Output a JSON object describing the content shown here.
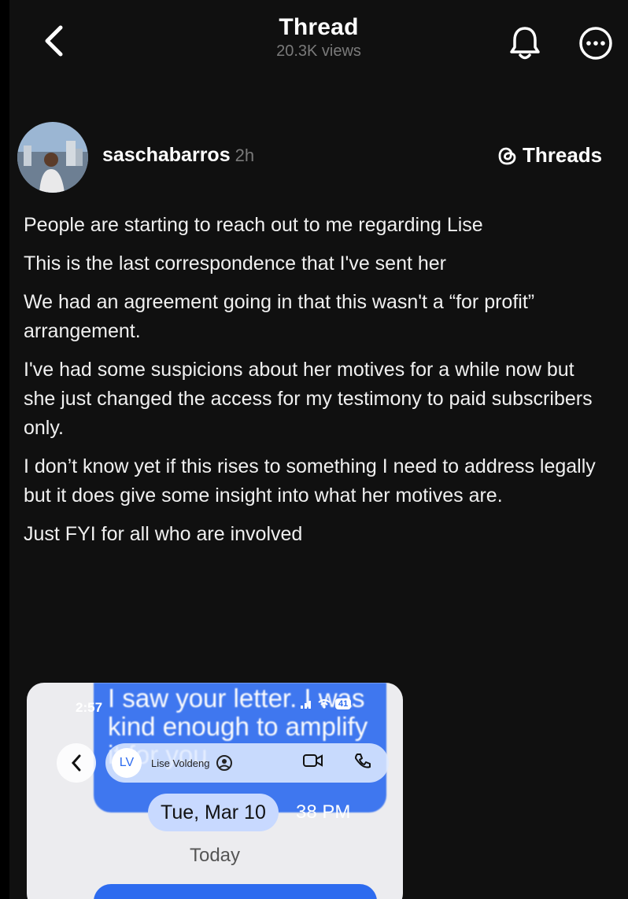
{
  "header": {
    "title": "Thread",
    "views": "20.3K views"
  },
  "post": {
    "username": "saschabarros",
    "time": "2h",
    "badge": "Threads",
    "paragraphs": [
      "People are starting to reach out to me regarding Lise",
      "This is the last correspondence that I've sent her",
      "We had an agreement going in that this wasn't a “for profit” arrangement.",
      "I've had some suspicions about her motives for a while now but she just changed the access for my testimony to paid subscribers only.",
      "I don’t know yet if this rises to something I need to address legally but it does give some insight into what her motives are.",
      "Just FYI for all who are involved"
    ]
  },
  "embed": {
    "status_time": "2:57",
    "battery": "41",
    "bubble_text": "I saw your letter. I was kind enough to amplify it for you",
    "initials": "LV",
    "contact_name": "Lise Voldeng",
    "date": "Tue, Mar 10",
    "sent_time": "38 PM",
    "today_label": "Today"
  },
  "colors": {
    "background": "#101010",
    "muted": "#7a7a7a",
    "imessage_blue": "#2d6bef"
  }
}
